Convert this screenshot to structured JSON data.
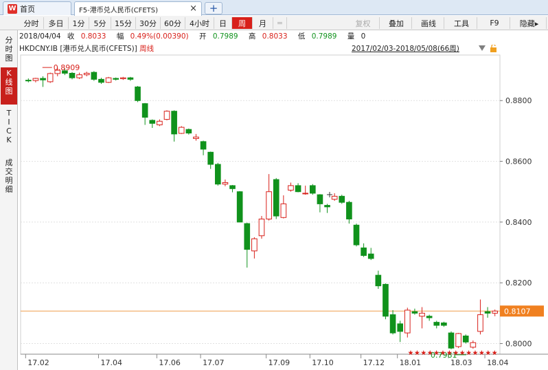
{
  "tabs": {
    "home_label": "首页",
    "home_logo": "W",
    "active_label": "F5-港币兑人民币(CFETS)",
    "close_symbol": "×",
    "new_symbol": "+"
  },
  "toolbar": {
    "periods": [
      "分时",
      "多日",
      "1分",
      "5分",
      "15分",
      "30分",
      "60分",
      "4小时",
      "日",
      "周",
      "月"
    ],
    "active_period": "周",
    "restore_label": "复权",
    "overlay_label": "叠加",
    "draw_label": "画线",
    "tools_label": "工具",
    "f9_label": "F9",
    "hide_label": "隐藏▸",
    "small_icon": "="
  },
  "sidebar": {
    "items": [
      {
        "label": "分时图",
        "active": false
      },
      {
        "label": "K线图",
        "active": true
      },
      {
        "label": "TICK",
        "active": false
      },
      {
        "label": "成交明细",
        "active": false
      }
    ]
  },
  "info": {
    "date": "2018/04/04",
    "close_label": "收",
    "close_value": "0.8033",
    "change_label": "幅",
    "change_value": "0.49%(0.00390)",
    "open_label": "开",
    "open_value": "0.7989",
    "high_label": "高",
    "high_value": "0.8033",
    "low_label": "低",
    "low_value": "0.7989",
    "volume_label": "量",
    "volume_value": "0"
  },
  "chart_header": {
    "symbol": "HKDCNY.IB [港币兑人民币(CFETS)]",
    "period": "周线",
    "range": "2017/02/03-2018/05/08(66周)"
  },
  "colors": {
    "up": "#d8201a",
    "down": "#10921c",
    "last_line": "#f0a860",
    "last_label_bg": "#f08020",
    "accent": "#d8201a"
  },
  "chart_data": {
    "type": "candlestick",
    "ylim": [
      0.7965,
      0.895
    ],
    "yticks": [
      0.88,
      0.86,
      0.84,
      0.82,
      0.8
    ],
    "ytick_labels": [
      "0.8800",
      "0.8600",
      "0.8400",
      "0.8200",
      "0.8000"
    ],
    "xtick_labels": [
      "17.02",
      "17.04",
      "17.06",
      "17.07",
      "17.09",
      "17.10",
      "17.12",
      "18.01",
      "18.03",
      "18.04"
    ],
    "xtick_index": [
      0,
      10,
      18,
      24,
      33,
      39,
      46,
      51,
      58,
      63
    ],
    "last_price": "0.8107",
    "max_label": "0.8909",
    "min_label": "0.7981",
    "candles": [
      [
        0.8867,
        0.8866,
        0.8873,
        0.886
      ],
      [
        0.8866,
        0.8873,
        0.8875,
        0.886
      ],
      [
        0.8873,
        0.8868,
        0.888,
        0.8845
      ],
      [
        0.8862,
        0.8889,
        0.8892,
        0.8858
      ],
      [
        0.8889,
        0.89,
        0.8909,
        0.888
      ],
      [
        0.8898,
        0.889,
        0.8906,
        0.8884
      ],
      [
        0.889,
        0.8875,
        0.8894,
        0.887
      ],
      [
        0.8875,
        0.8885,
        0.8892,
        0.8871
      ],
      [
        0.8885,
        0.889,
        0.8895,
        0.888
      ],
      [
        0.8893,
        0.887,
        0.8897,
        0.8865
      ],
      [
        0.887,
        0.886,
        0.8875,
        0.8855
      ],
      [
        0.886,
        0.8875,
        0.8878,
        0.8858
      ],
      [
        0.8873,
        0.887,
        0.8876,
        0.8866
      ],
      [
        0.8872,
        0.8875,
        0.8878,
        0.8868
      ],
      [
        0.8875,
        0.887,
        0.8878,
        0.8865
      ],
      [
        0.8845,
        0.88,
        0.8848,
        0.8795
      ],
      [
        0.879,
        0.8745,
        0.8792,
        0.872
      ],
      [
        0.8735,
        0.8725,
        0.8738,
        0.871
      ],
      [
        0.872,
        0.8732,
        0.8738,
        0.8716
      ],
      [
        0.8738,
        0.8765,
        0.8768,
        0.8735
      ],
      [
        0.8765,
        0.869,
        0.8768,
        0.8665
      ],
      [
        0.8692,
        0.8712,
        0.8716,
        0.869
      ],
      [
        0.8705,
        0.8693,
        0.8708,
        0.8688
      ],
      [
        0.8675,
        0.868,
        0.869,
        0.8668
      ],
      [
        0.8665,
        0.864,
        0.8668,
        0.862
      ],
      [
        0.863,
        0.859,
        0.8632,
        0.8575
      ],
      [
        0.859,
        0.8525,
        0.8595,
        0.852
      ],
      [
        0.8525,
        0.853,
        0.854,
        0.8518
      ],
      [
        0.852,
        0.851,
        0.8522,
        0.8498
      ],
      [
        0.85,
        0.84,
        0.8502,
        0.84
      ],
      [
        0.8395,
        0.831,
        0.8398,
        0.825
      ],
      [
        0.8305,
        0.8345,
        0.835,
        0.828
      ],
      [
        0.8355,
        0.841,
        0.842,
        0.8345
      ],
      [
        0.841,
        0.85,
        0.8558,
        0.8405
      ],
      [
        0.854,
        0.842,
        0.8545,
        0.841
      ],
      [
        0.8415,
        0.846,
        0.8488,
        0.8412
      ],
      [
        0.8505,
        0.852,
        0.853,
        0.85
      ],
      [
        0.852,
        0.85,
        0.8528,
        0.8498
      ],
      [
        0.8495,
        0.8495,
        0.852,
        0.849
      ],
      [
        0.852,
        0.8495,
        0.8525,
        0.849
      ],
      [
        0.849,
        0.846,
        0.8492,
        0.8432
      ],
      [
        0.8455,
        0.845,
        0.846,
        0.843
      ],
      [
        0.8475,
        0.8485,
        0.8495,
        0.847
      ],
      [
        0.8485,
        0.8465,
        0.849,
        0.846
      ],
      [
        0.8465,
        0.841,
        0.847,
        0.8395
      ],
      [
        0.839,
        0.8325,
        0.8395,
        0.832
      ],
      [
        0.8315,
        0.829,
        0.833,
        0.8285
      ],
      [
        0.8295,
        0.828,
        0.8315,
        0.8275
      ],
      [
        0.8225,
        0.819,
        0.824,
        0.818
      ],
      [
        0.8195,
        0.809,
        0.8198,
        0.808
      ],
      [
        0.8095,
        0.8035,
        0.811,
        0.803
      ],
      [
        0.8065,
        0.804,
        0.8075,
        0.8005
      ],
      [
        0.8035,
        0.811,
        0.8118,
        0.802
      ],
      [
        0.8105,
        0.81,
        0.8115,
        0.8095
      ],
      [
        0.809,
        0.81,
        0.812,
        0.805
      ],
      [
        0.809,
        0.8085,
        0.8095,
        0.8075
      ],
      [
        0.807,
        0.806,
        0.8075,
        0.805
      ],
      [
        0.8068,
        0.806,
        0.8072,
        0.8055
      ],
      [
        0.8035,
        0.7985,
        0.804,
        0.7981
      ],
      [
        0.799,
        0.8033,
        0.8035,
        0.7985
      ],
      [
        0.8025,
        0.8005,
        0.803,
        0.8
      ],
      [
        0.7988,
        0.8003,
        0.801,
        0.7983
      ],
      [
        0.804,
        0.8095,
        0.8145,
        0.803
      ],
      [
        0.8105,
        0.81,
        0.812,
        0.8085
      ],
      [
        0.81,
        0.8107,
        0.8112,
        0.809
      ]
    ]
  }
}
